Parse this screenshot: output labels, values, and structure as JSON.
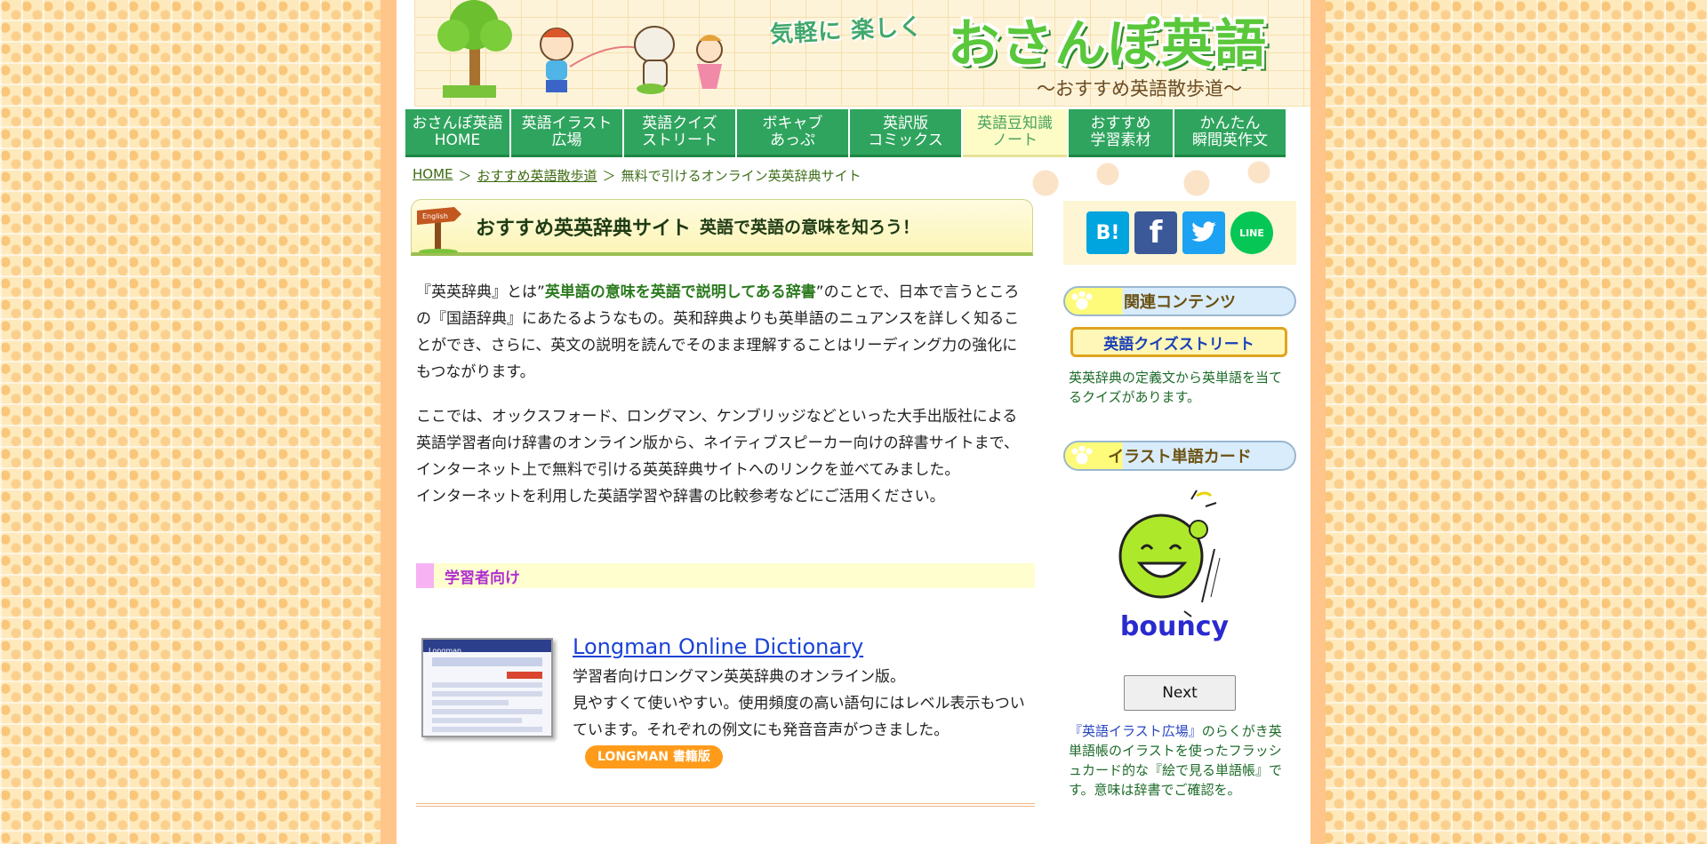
{
  "header": {
    "tagline": "気軽に 楽しく",
    "site_title": "おさんぽ英語",
    "subtitle": "〜おすすめ英語散歩道〜"
  },
  "nav": [
    {
      "line1": "おさんぽ英語",
      "line2": "HOME"
    },
    {
      "line1": "英語イラスト",
      "line2": "広場"
    },
    {
      "line1": "英語クイズ",
      "line2": "ストリート"
    },
    {
      "line1": "ボキャブ",
      "line2": "あっぷ"
    },
    {
      "line1": "英訳版",
      "line2": "コミックス"
    },
    {
      "line1": "英語豆知識",
      "line2": "ノート"
    },
    {
      "line1": "おすすめ",
      "line2": "学習素材"
    },
    {
      "line1": "かんたん",
      "line2": "瞬間英作文"
    }
  ],
  "breadcrumb": {
    "home": "HOME",
    "sep": "＞",
    "parent": "おすすめ英語散歩道",
    "current": "無料で引けるオンライン英英辞典サイト"
  },
  "heading": {
    "signpost_text": "English",
    "main": "おすすめ英英辞典サイト",
    "sub": "英語で英語の意味を知ろう！"
  },
  "intro": {
    "p1_before": "『英英辞典』とは”",
    "p1_strong": "英単語の意味を英語で説明してある辞書",
    "p1_after": "”のことで、日本で言うところの『国語辞典』にあたるようなもの。英和辞典よりも英単語のニュアンスを詳しく知ることができ、さらに、英文の説明を読んでそのまま理解することはリーディング力の強化にもつながります。",
    "p2": "ここでは、オックスフォード、ロングマン、ケンブリッジなどといった大手出版社による英語学習者向け辞書のオンライン版から、ネイティブスピーカー向けの辞書サイトまで、インターネット上で無料で引ける英英辞典サイトへのリンクを並べてみました。",
    "p3": "インターネットを利用した英語学習や辞書の比較参考などにご活用ください。"
  },
  "section": {
    "title": "学習者向け"
  },
  "dictionary": {
    "thumb_brand": "Longman",
    "name": "Longman Online Dictionary",
    "line1": "学習者向けロングマン英英辞典のオンライン版。",
    "line2": "見やすくて使いやすい。使用頻度の高い語句にはレベル表示もついています。それぞれの例文にも発音音声がつきました。",
    "badge": "LONGMAN 書籍版"
  },
  "sidebar": {
    "share": {
      "hatena": "B!",
      "facebook": "f",
      "twitter_icon": "twitter-bird",
      "line": "LINE"
    },
    "related_title": "関連コンテンツ",
    "quiz_button": "英語クイズストリート",
    "quiz_desc": "英英辞典の定義文から英単語を当てるクイズがあります。",
    "card_title": "イラスト単語カード",
    "card_word": "bouncy",
    "next": "Next",
    "card_desc_link": "『英語イラスト広場』",
    "card_desc": "のらくがき英単語帳のイラストを使ったフラッシュカード的な『絵で見る単語帳』です。意味は辞書でご確認を。"
  },
  "colors": {
    "nav_green": "#2fa45e",
    "nav_active": "#fdfcc7",
    "link_blue": "#1a42d6",
    "frame_orange": "#ffc58a",
    "badge_orange": "#ff9b1a",
    "section_purple": "#b030d0"
  }
}
